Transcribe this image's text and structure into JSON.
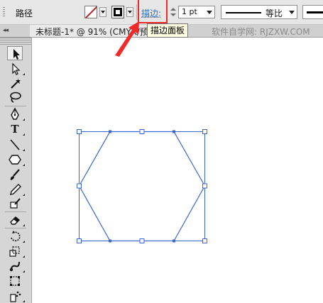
{
  "control_bar": {
    "label": "路径",
    "fill_swatch": "none",
    "stroke_swatch": "black",
    "stroke_link": "描边:",
    "weight_value": "1 pt",
    "profile_label": "等比"
  },
  "tooltip": "描边面板",
  "document": {
    "tab_title": "未标题-1* @ 91% (CMYK/预",
    "watermark": "软件自学网: RJZXW.COM",
    "panel_collapse": "◂◂"
  },
  "tools": [
    {
      "name": "selection-tool",
      "icon": "black-arrow"
    },
    {
      "name": "direct-selection-tool",
      "icon": "white-arrow"
    },
    {
      "name": "magic-wand-tool",
      "icon": "wand"
    },
    {
      "name": "lasso-tool",
      "icon": "lasso"
    },
    {
      "name": "pen-tool",
      "icon": "pen-nib"
    },
    {
      "name": "type-tool",
      "icon": "T",
      "label": "T"
    },
    {
      "name": "line-segment-tool",
      "icon": "diagonal-line"
    },
    {
      "name": "polygon-tool",
      "icon": "hexagon"
    },
    {
      "name": "paintbrush-tool",
      "icon": "brush"
    },
    {
      "name": "pencil-tool",
      "icon": "pencil"
    },
    {
      "name": "blob-brush-tool",
      "icon": "blob-brush"
    },
    {
      "name": "eraser-tool",
      "icon": "eraser"
    },
    {
      "name": "rotate-tool",
      "icon": "rotate"
    },
    {
      "name": "scale-tool",
      "icon": "scale"
    },
    {
      "name": "warp-tool",
      "icon": "warp"
    },
    {
      "name": "free-transform-tool",
      "icon": "free-transform"
    },
    {
      "name": "symbol-sprayer-tool",
      "icon": "sprayer"
    }
  ],
  "colors": {
    "selection_blue": "#3a66d4",
    "annotation_red": "#ee2a2a",
    "link_blue": "#1b6fd6",
    "panel_gray": "#d6d6d6"
  },
  "artwork": {
    "shape": "hexagon",
    "state": "selected"
  }
}
